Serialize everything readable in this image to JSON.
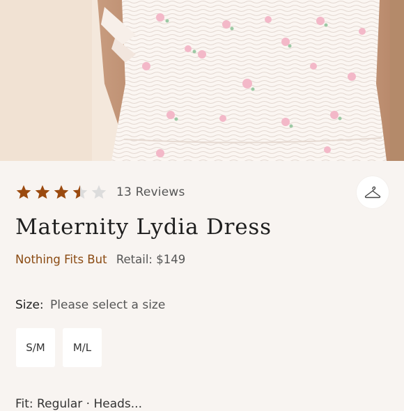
{
  "rating": {
    "value": 3.5,
    "max": 5,
    "reviews_label": "13 Reviews"
  },
  "product": {
    "title": "Maternity Lydia Dress",
    "brand": "Nothing Fits But",
    "retail_label": "Retail: $149"
  },
  "size": {
    "label": "Size:",
    "prompt": "Please select a size",
    "options": [
      "S/M",
      "M/L"
    ]
  },
  "fit": {
    "text": "Fit: Regular · Heads..."
  },
  "colors": {
    "star_filled": "#9b4a0f",
    "star_empty": "#dcdcdc",
    "brand": "#8a4a12",
    "background": "#f8f4f1"
  },
  "icons": {
    "save": "hanger-icon",
    "rating": "star-icon"
  }
}
